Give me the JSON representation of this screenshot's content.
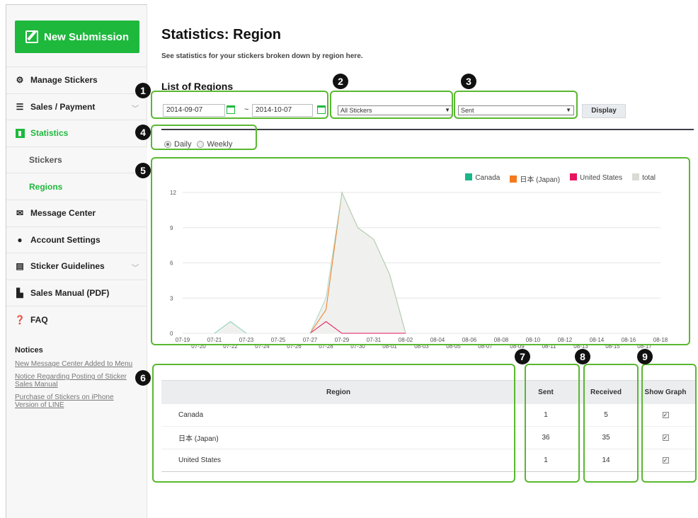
{
  "sidebar": {
    "new_submission": "New Submission",
    "items": [
      {
        "label": "Manage Stickers",
        "icon": "gear-icon"
      },
      {
        "label": "Sales / Payment",
        "icon": "database-icon"
      },
      {
        "label": "Statistics",
        "icon": "bar-chart-icon"
      },
      {
        "label": "Stickers"
      },
      {
        "label": "Regions"
      },
      {
        "label": "Message Center",
        "icon": "envelope-icon"
      },
      {
        "label": "Account Settings",
        "icon": "user-icon"
      },
      {
        "label": "Sticker Guidelines",
        "icon": "document-icon"
      },
      {
        "label": "Sales Manual (PDF)",
        "icon": "file-icon"
      },
      {
        "label": "FAQ",
        "icon": "question-icon"
      }
    ],
    "notices_title": "Notices",
    "notices": [
      "New Message Center Added to Menu",
      "Notice Regarding Posting of Sticker Sales Manual",
      "Purchase of Stickers on iPhone Version of LINE"
    ]
  },
  "page": {
    "title": "Statistics: Region",
    "subtitle": "See statistics for your stickers broken down by region here.",
    "list_title": "List of Regions",
    "date_from": "2014-09-07",
    "date_to": "2014-10-07",
    "tilde": "~",
    "sticker_select": "All Stickers",
    "type_select": "Sent",
    "display_button": "Display",
    "radio_daily": "Daily",
    "radio_weekly": "Weekly"
  },
  "table": {
    "headers": [
      "Region",
      "Sent",
      "Received",
      "Show Graph"
    ],
    "rows": [
      {
        "region": "Canada",
        "sent": "1",
        "received": "5"
      },
      {
        "region": "日本 (Japan)",
        "sent": "36",
        "received": "35"
      },
      {
        "region": "United States",
        "sent": "1",
        "received": "14"
      }
    ]
  },
  "badges": [
    "1",
    "2",
    "3",
    "4",
    "5",
    "6",
    "7",
    "8",
    "9"
  ],
  "colors": {
    "accent": "#1eb83d",
    "annotation": "#59b830",
    "canada": "#1ab58a",
    "japan": "#f47a20",
    "us": "#e8135f",
    "total": "#d9dcd6"
  },
  "chart_data": {
    "type": "area",
    "legend": [
      "Canada",
      "日本 (Japan)",
      "United States",
      "total"
    ],
    "x": [
      "07-19",
      "07-20",
      "07-21",
      "07-22",
      "07-23",
      "07-24",
      "07-25",
      "07-26",
      "07-27",
      "07-28",
      "07-29",
      "07-30",
      "07-31",
      "08-01",
      "08-02",
      "08-03",
      "08-04",
      "08-05",
      "08-06",
      "08-07",
      "08-08",
      "08-09",
      "08-10",
      "08-11",
      "08-12",
      "08-13",
      "08-14",
      "08-15",
      "08-16",
      "08-17",
      "08-18"
    ],
    "yticks": [
      "0",
      "3",
      "6",
      "9",
      "12"
    ],
    "ylim": [
      0,
      12
    ],
    "series": [
      {
        "name": "Canada",
        "values": [
          0,
          0,
          0,
          1,
          0,
          0,
          0,
          0,
          0,
          0,
          0,
          0,
          0,
          0,
          0,
          0,
          0,
          0,
          0,
          0,
          0,
          0,
          0,
          0,
          0,
          0,
          0,
          0,
          0,
          0,
          0
        ]
      },
      {
        "name": "日本 (Japan)",
        "values": [
          0,
          0,
          0,
          0,
          0,
          0,
          0,
          0,
          0,
          2,
          12,
          9,
          8,
          5,
          0,
          0,
          0,
          0,
          0,
          0,
          0,
          0,
          0,
          0,
          0,
          0,
          0,
          0,
          0,
          0,
          0
        ]
      },
      {
        "name": "United States",
        "values": [
          0,
          0,
          0,
          0,
          0,
          0,
          0,
          0,
          0,
          1,
          0,
          0,
          0,
          0,
          0,
          0,
          0,
          0,
          0,
          0,
          0,
          0,
          0,
          0,
          0,
          0,
          0,
          0,
          0,
          0,
          0
        ]
      },
      {
        "name": "total",
        "values": [
          0,
          0,
          0,
          1,
          0,
          0,
          0,
          0,
          0,
          3,
          12,
          9,
          8,
          5,
          0,
          0,
          0,
          0,
          0,
          0,
          0,
          0,
          0,
          0,
          0,
          0,
          0,
          0,
          0,
          0,
          0
        ]
      }
    ]
  }
}
